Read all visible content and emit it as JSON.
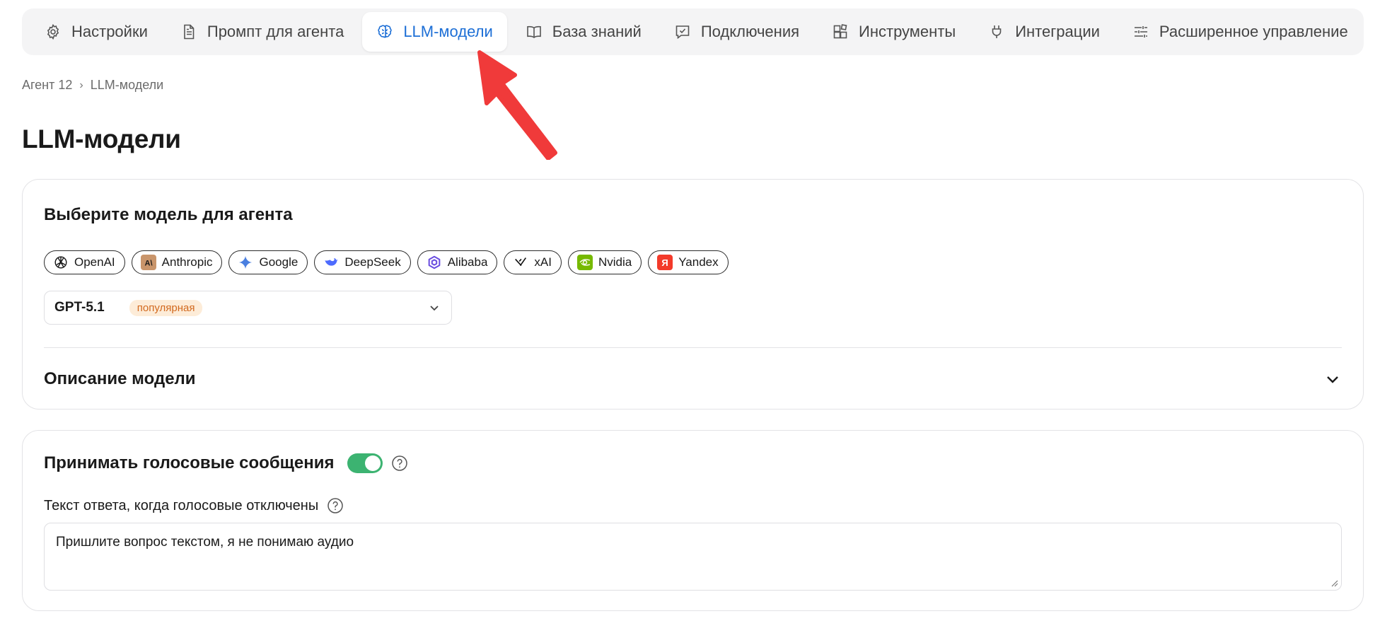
{
  "tabs": [
    {
      "label": "Настройки",
      "icon": "gear-icon"
    },
    {
      "label": "Промпт для агента",
      "icon": "document-icon"
    },
    {
      "label": "LLM-модели",
      "icon": "brain-icon",
      "active": true
    },
    {
      "label": "База знаний",
      "icon": "book-icon"
    },
    {
      "label": "Подключения",
      "icon": "chat-check-icon"
    },
    {
      "label": "Инструменты",
      "icon": "blocks-icon"
    },
    {
      "label": "Интеграции",
      "icon": "plug-icon"
    },
    {
      "label": "Расширенное управление",
      "icon": "sliders-icon"
    }
  ],
  "breadcrumb": {
    "agent": "Агент 12",
    "separator": "›",
    "current": "LLM-модели"
  },
  "page_title": "LLM-модели",
  "model_card": {
    "heading": "Выберите модель для агента",
    "vendors": [
      "OpenAI",
      "Anthropic",
      "Google",
      "DeepSeek",
      "Alibaba",
      "xAI",
      "Nvidia",
      "Yandex"
    ],
    "selected_model": "GPT-5.1",
    "selected_badge": "популярная",
    "description_label": "Описание модели"
  },
  "voice_card": {
    "accept_voice_label": "Принимать голосовые сообщения",
    "accept_voice_enabled": true,
    "reply_label": "Текст ответа, когда голосовые отключены",
    "reply_value": "Пришлите вопрос текстом, я не понимаю аудио"
  },
  "colors": {
    "accent": "#1d6fd6",
    "toggle_on": "#3cb371",
    "badge_text": "#d2691e",
    "badge_bg": "#fdecd8",
    "annotation_arrow": "#f03a3a"
  }
}
